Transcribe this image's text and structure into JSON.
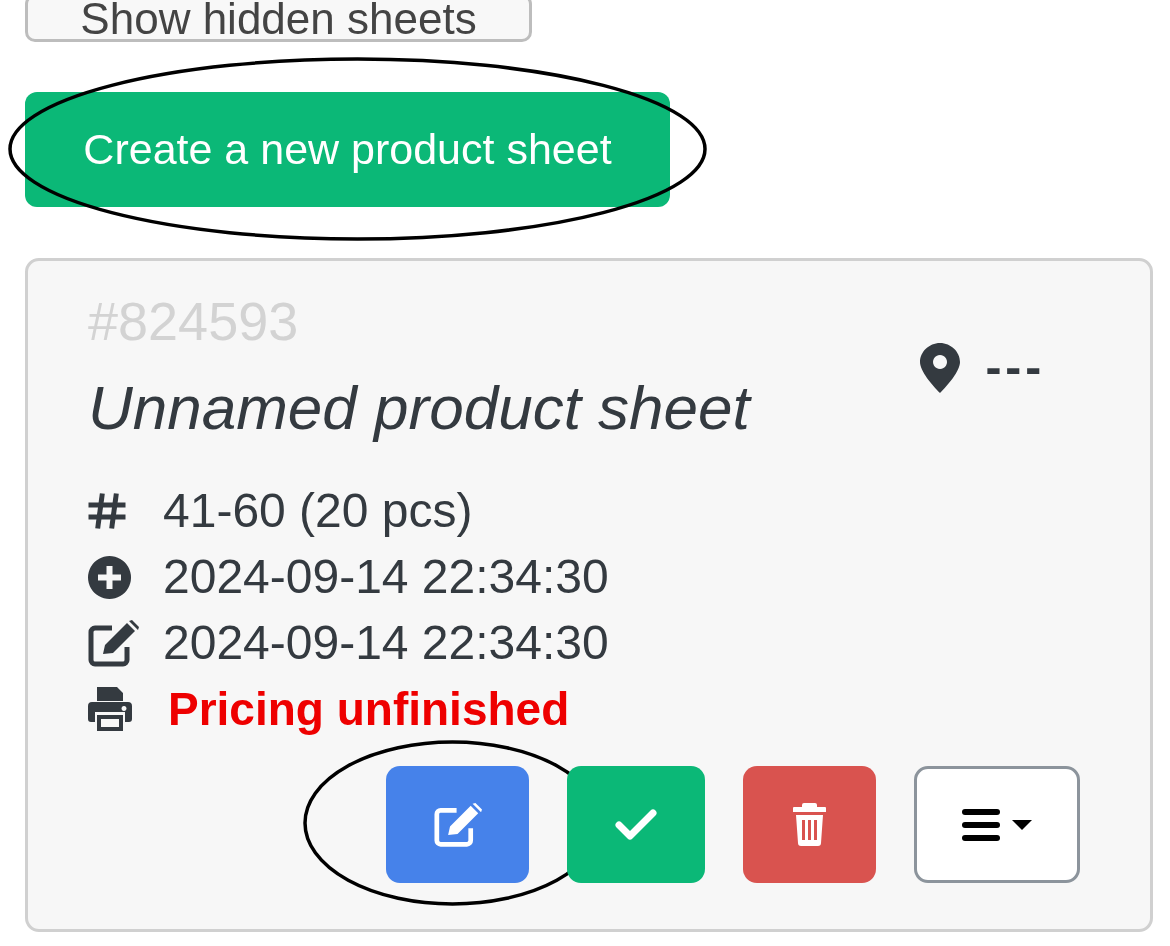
{
  "show_hidden_button": {
    "label": "Show hidden sheets"
  },
  "create_button": {
    "label": "Create a new product sheet",
    "circled": true
  },
  "sheet_card": {
    "id": "#824593",
    "title": "Unnamed product sheet",
    "location": "---",
    "details": [
      {
        "kind": "range",
        "text": "41-60 (20 pcs)",
        "alert": false
      },
      {
        "kind": "created",
        "text": "2024-09-14 22:34:30",
        "alert": false
      },
      {
        "kind": "modified",
        "text": "2024-09-14 22:34:30",
        "alert": false
      },
      {
        "kind": "print_status",
        "text": "Pricing unfinished",
        "alert": true
      }
    ],
    "actions": [
      {
        "kind": "edit",
        "circled": true
      },
      {
        "kind": "approve",
        "circled": false
      },
      {
        "kind": "delete",
        "circled": false
      },
      {
        "kind": "menu",
        "circled": false
      }
    ]
  }
}
